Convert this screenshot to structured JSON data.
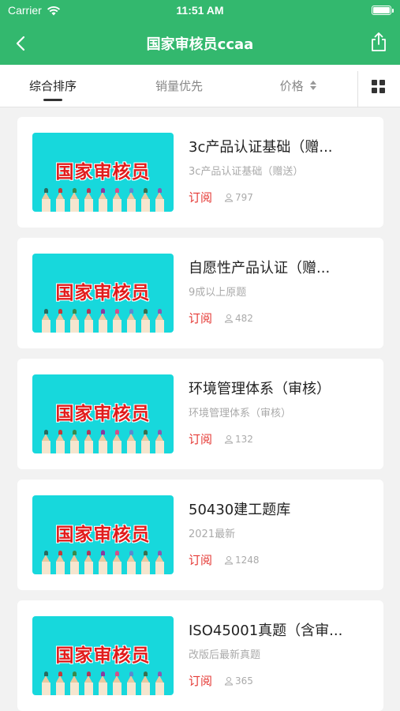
{
  "status_bar": {
    "carrier": "Carrier",
    "time": "11:51 AM"
  },
  "nav": {
    "title": "国家审核员ccaa",
    "back_icon": "chevron-left-icon",
    "share_icon": "share-icon"
  },
  "filters": {
    "items": [
      {
        "label": "综合排序",
        "active": true
      },
      {
        "label": "销量优先",
        "active": false
      },
      {
        "label": "价格",
        "active": false
      }
    ],
    "grid_icon": "grid-icon"
  },
  "thumbnail_text": "国家审核员",
  "colors": {
    "brand": "#33b86e",
    "subscribe": "#e53935",
    "thumb_bg": "#17d8dc"
  },
  "courses": [
    {
      "title": "3c产品认证基础（赠...",
      "subtitle": "3c产品认证基础（赠送）",
      "action": "订阅",
      "count": "797"
    },
    {
      "title": "自愿性产品认证（赠...",
      "subtitle": "9成以上原题",
      "action": "订阅",
      "count": "482"
    },
    {
      "title": "环境管理体系（审核）",
      "subtitle": "环境管理体系（审核）",
      "action": "订阅",
      "count": "132"
    },
    {
      "title": "50430建工题库",
      "subtitle": "2021最新",
      "action": "订阅",
      "count": "1248"
    },
    {
      "title": "ISO45001真题（含审...",
      "subtitle": "改版后最新真题",
      "action": "订阅",
      "count": "365"
    }
  ]
}
